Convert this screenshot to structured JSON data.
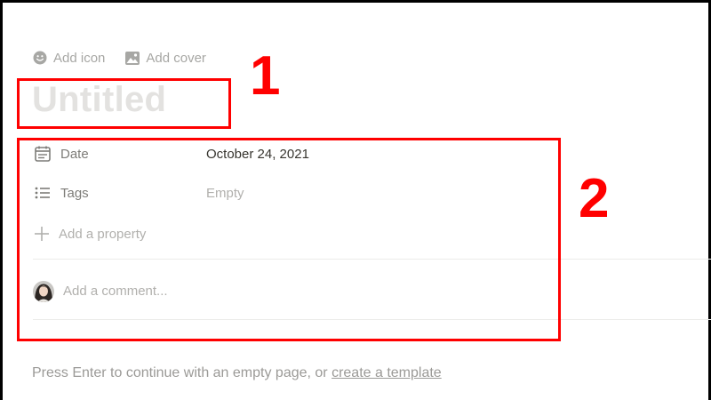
{
  "toolbar": {
    "add_icon_label": "Add icon",
    "add_cover_label": "Add cover"
  },
  "page": {
    "title_placeholder": "Untitled"
  },
  "properties": [
    {
      "icon": "calendar-icon",
      "name": "Date",
      "value": "October 24, 2021",
      "is_empty": false
    },
    {
      "icon": "list-icon",
      "name": "Tags",
      "value": "Empty",
      "is_empty": true
    }
  ],
  "add_property_label": "Add a property",
  "comment": {
    "placeholder": "Add a comment..."
  },
  "footer": {
    "hint_text": "Press Enter to continue with an empty page, or ",
    "template_link": "create a template"
  },
  "annotations": {
    "label_1": "1",
    "label_2": "2",
    "color": "#ff0000"
  }
}
